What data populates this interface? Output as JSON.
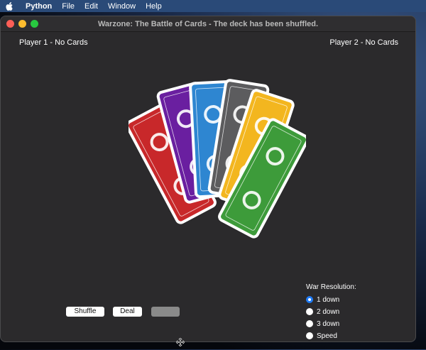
{
  "menubar": {
    "app": "Python",
    "items": [
      "File",
      "Edit",
      "Window",
      "Help"
    ]
  },
  "window": {
    "title": "Warzone: The Battle of Cards - The deck has been shuffled."
  },
  "players": {
    "p1": "Player 1 - No Cards",
    "p2": "Player 2 - No Cards"
  },
  "cards": {
    "icon": "card-fan-icon",
    "colors": [
      "#c8282a",
      "#6a1fa0",
      "#2e86d1",
      "#5c5c5e",
      "#f3b61f",
      "#3d9b3a"
    ]
  },
  "buttons": {
    "shuffle": "Shuffle",
    "deal": "Deal",
    "third": ""
  },
  "war": {
    "title": "War Resolution:",
    "options": [
      "1 down",
      "2 down",
      "3 down",
      "Speed"
    ],
    "selected": "1 down"
  }
}
